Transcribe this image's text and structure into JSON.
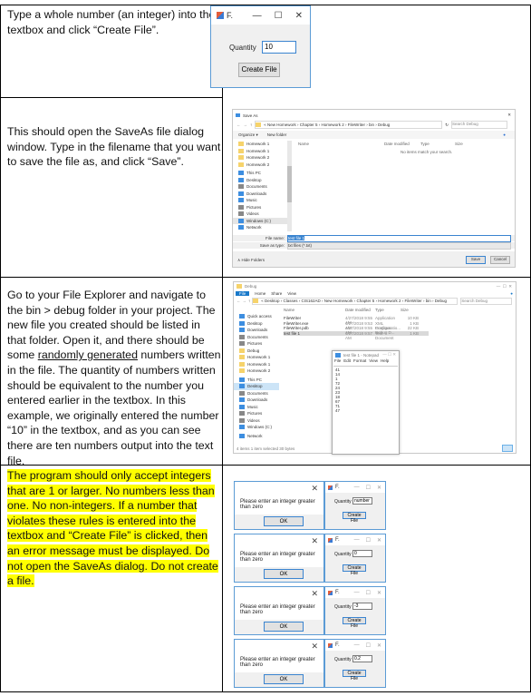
{
  "rows": [
    {
      "instruction": "Type a whole number (an integer) into the textbox and click “Create File”."
    },
    {
      "instruction": "This should open the SaveAs file dialog window.  Type in the filename that you want to save the file as, and click “Save”."
    },
    {
      "instruction_before": "Go to your File Explorer and navigate to the bin > debug folder in your project.  The new file you created should be listed in that folder.  Open it, and there should be some ",
      "instruction_underlined": "randomly generated",
      "instruction_after": " numbers written in the file.  The quantity of numbers written should be equivalent to the number you entered earlier in the textbox.  In this example, we originally entered the number “10” in the textbox, and as you can see there are ten numbers output into the text file."
    },
    {
      "instruction": "The program should only accept integers that are 1 or larger.  No numbers less than one.  No non-integers.  If a number that violates these rules is entered into the textbox and “Create File” is clicked, then an error message must be displayed.  Do not open the SaveAs dialog.  Do not create a file.",
      "highlight_color": "#ffff00"
    }
  ],
  "form": {
    "title": "F.",
    "minimize": "—",
    "maximize": "☐",
    "close": "✕",
    "quantity_label": "Quantity",
    "quantity_value": "10",
    "create_button": "Create File"
  },
  "saveas": {
    "title": "Save As",
    "close": "✕",
    "breadcrumb": "«  New Homework  ›  Chapter 5  ›  Homework 2  ›  FileWriter  ›  bin  ›  Debug",
    "search_placeholder": "Search Debug",
    "organize": "Organize ▾",
    "new_folder": "New folder",
    "columns": [
      "Name",
      "Date modified",
      "Type",
      "Size"
    ],
    "empty_message": "No items match your search.",
    "nav": [
      "Homework 1",
      "Homework 1",
      "Homework 2",
      "Homework 2",
      "This PC",
      "Desktop",
      "Documents",
      "Downloads",
      "Music",
      "Pictures",
      "Videos",
      "Windows (C:)",
      "Network"
    ],
    "file_name_label": "File name:",
    "file_name_value": "test file 1",
    "save_type_label": "Save as type:",
    "save_type_value": "txt files (*.txt)",
    "hide_folders": "∧  Hide Folders",
    "save_button": "Save",
    "cancel_button": "Cancel"
  },
  "explorer": {
    "title": "Debug",
    "ribbon_tabs": [
      "File",
      "Home",
      "Share",
      "View"
    ],
    "breadcrumb": "«  Desktop  ›  Classes  ›  CIS162AD  ›  New Homework  ›  Chapter 5  ›  Homework 2  ›  FileWriter  ›  bin  ›  Debug",
    "search_placeholder": "Search Debug",
    "nav": [
      "Quick access",
      "Desktop",
      "Downloads",
      "Documents",
      "Pictures",
      "Debug",
      "Homework 1",
      "Homework 1",
      "Homework 2",
      "This PC",
      "Desktop",
      "Documents",
      "Downloads",
      "Music",
      "Pictures",
      "Videos",
      "Windows (C:)",
      "Network"
    ],
    "columns": [
      "Name",
      "Date modified",
      "Type",
      "Size"
    ],
    "files": [
      {
        "name": "FileWriter",
        "date": "4/27/2018 9:55 AM",
        "type": "Application",
        "size": "10 KB"
      },
      {
        "name": "FileWriter.exe",
        "date": "4/27/2018 9:53 AM",
        "type": "XML Configuratio...",
        "size": "1 KB"
      },
      {
        "name": "FileWriter.pdb",
        "date": "4/27/2018 9:55 AM",
        "type": "Program Debug D...",
        "size": "22 KB"
      },
      {
        "name": "test file 1",
        "date": "4/27/2018 9:57 AM",
        "type": "Text Document",
        "size": "1 KB"
      }
    ],
    "status": "4 items    1 item selected  30 bytes"
  },
  "notepad": {
    "title": "test file 1 - Notepad",
    "menu": [
      "File",
      "Edit",
      "Format",
      "View",
      "Help"
    ],
    "numbers": [
      "41",
      "14",
      "1",
      "72",
      "24",
      "23",
      "18",
      "67",
      "71",
      "47"
    ]
  },
  "errors": [
    {
      "message": "Please enter an integer greater than zero",
      "ok": "OK",
      "close": "✕",
      "input": "number"
    },
    {
      "message": "Please enter an integer greater than zero",
      "ok": "OK",
      "close": "✕",
      "input": "0"
    },
    {
      "message": "Please enter an integer greater than zero",
      "ok": "OK",
      "close": "✕",
      "input": "-3"
    },
    {
      "message": "Please enter an integer greater than zero",
      "ok": "OK",
      "close": "✕",
      "input": "0.2"
    }
  ],
  "mini_form": {
    "title": "F.",
    "quantity_label": "Quantity",
    "create_button": "Create File"
  }
}
